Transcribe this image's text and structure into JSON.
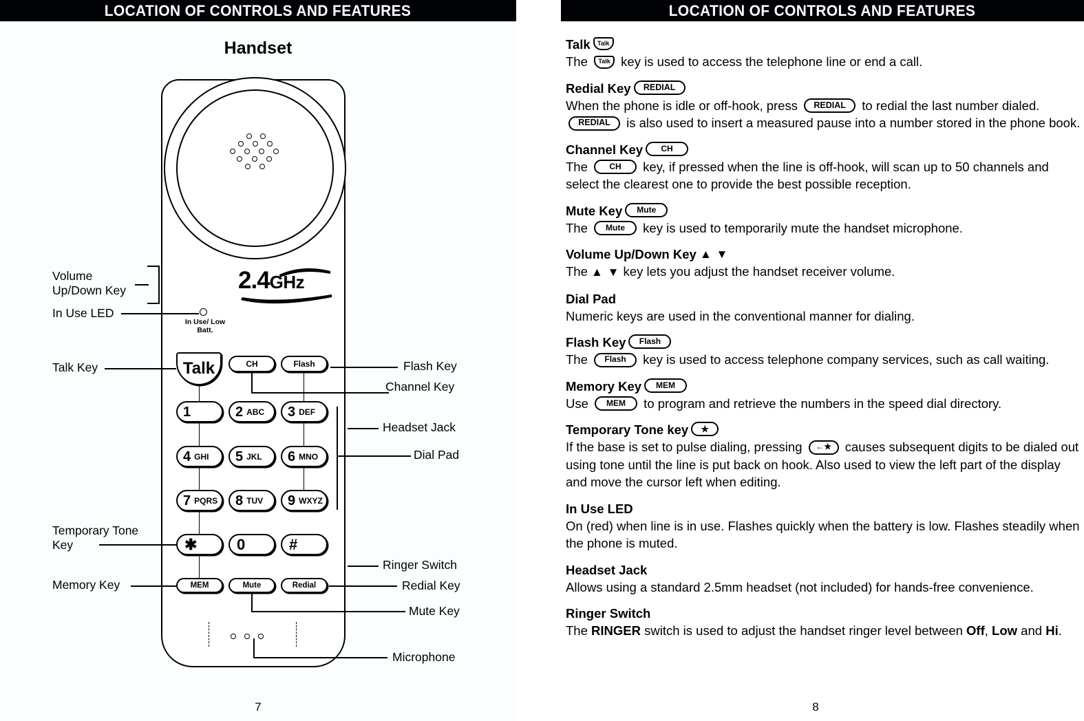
{
  "left_page": {
    "banner_title": "LOCATION OF CONTROLS AND FEATURES",
    "diagram_title": "Handset",
    "page_number": "7",
    "logo": {
      "number": "2.4",
      "unit": "GHz"
    },
    "led_label": "In Use/\nLow Batt.",
    "keys": {
      "talk": "Talk",
      "ch": "CH",
      "flash": "Flash",
      "mem": "MEM",
      "mute": "Mute",
      "redial": "Redial",
      "star": "✱",
      "zero": "0",
      "hash": "#"
    },
    "dial_pad": [
      {
        "digit": "1",
        "letters": ""
      },
      {
        "digit": "2",
        "letters": "ABC"
      },
      {
        "digit": "3",
        "letters": "DEF"
      },
      {
        "digit": "4",
        "letters": "GHI"
      },
      {
        "digit": "5",
        "letters": "JKL"
      },
      {
        "digit": "6",
        "letters": "MNO"
      },
      {
        "digit": "7",
        "letters": "PQRS"
      },
      {
        "digit": "8",
        "letters": "TUV"
      },
      {
        "digit": "9",
        "letters": "WXYZ"
      }
    ],
    "callouts_left": [
      "Volume\nUp/Down Key",
      "In Use LED",
      "Talk Key",
      "Temporary Tone\nKey",
      "Memory Key"
    ],
    "callouts_right": [
      "Flash Key",
      "Channel Key",
      "Headset Jack",
      "Dial Pad",
      "Ringer Switch",
      "Redial Key",
      "Mute Key",
      "Microphone"
    ]
  },
  "right_page": {
    "banner_title": "LOCATION OF CONTROLS AND FEATURES",
    "page_number": "8",
    "sections": [
      {
        "id": "talk",
        "head_text": "Talk",
        "head_key": "Talk",
        "body_pre": "The ",
        "body_key": "Talk",
        "body_post": " key is used to access the telephone line or end a call."
      },
      {
        "id": "redial",
        "head_text": "Redial Key",
        "head_key": "REDIAL",
        "body_pre": "When the phone is idle or off-hook, press ",
        "body_key": "REDIAL",
        "body_mid": " to redial the last number dialed.  ",
        "body_key2": "REDIAL",
        "body_post": " is also used to insert a measured pause into a number stored in the phone book."
      },
      {
        "id": "channel",
        "head_text": "Channel Key",
        "head_key": "CH",
        "body_pre": "The ",
        "body_key": "CH",
        "body_post": " key, if pressed when the line is off-hook, will scan up to 50 channels and select the clearest one to provide the best possible reception."
      },
      {
        "id": "mute",
        "head_text": "Mute Key",
        "head_key": "Mute",
        "body_pre": "The ",
        "body_key": "Mute",
        "body_post": " key is used to temporarily mute the handset microphone."
      },
      {
        "id": "volume",
        "head_text": "Volume Up/Down Key",
        "head_arrows": "▲ ▼",
        "body_pre": "The ",
        "body_arrows": "▲ ▼",
        "body_post": " key lets you adjust the handset receiver volume."
      },
      {
        "id": "dial-pad",
        "head_text": "Dial Pad",
        "body_post": "Numeric keys are used in the conventional manner for dialing."
      },
      {
        "id": "flash",
        "head_text": "Flash Key",
        "head_key": "Flash",
        "body_pre": "The ",
        "body_key": "Flash",
        "body_post": " key is used to access telephone company services, such as call waiting."
      },
      {
        "id": "memory",
        "head_text": "Memory Key",
        "head_key": "MEM",
        "body_pre": "Use ",
        "body_key": "MEM",
        "body_post": " to program and retrieve the numbers in the speed dial directory."
      },
      {
        "id": "temporary-tone",
        "head_text": "Temporary Tone key",
        "head_key": "★",
        "body_pre": "If the base is set to pulse dialing, pressing ",
        "body_key": "←★",
        "body_post": " causes subsequent digits to be dialed out using tone until the line is put back on hook.  Also used to view the left part of the display and move the cursor left when editing."
      },
      {
        "id": "in-use-led",
        "head_text": "In Use LED",
        "body_post": "On (red) when line is in use.  Flashes quickly when the battery is low.  Flashes steadily when the phone is muted."
      },
      {
        "id": "headset-jack",
        "head_text": "Headset Jack",
        "body_post": "Allows using a standard 2.5mm headset (not included) for hands-free convenience."
      },
      {
        "id": "ringer-switch",
        "head_text": "Ringer Switch",
        "body_parts": [
          "The ",
          "RINGER",
          " switch is used to adjust the handset ringer level between ",
          "Off",
          ", ",
          "Low",
          " and ",
          "Hi",
          "."
        ]
      }
    ]
  }
}
